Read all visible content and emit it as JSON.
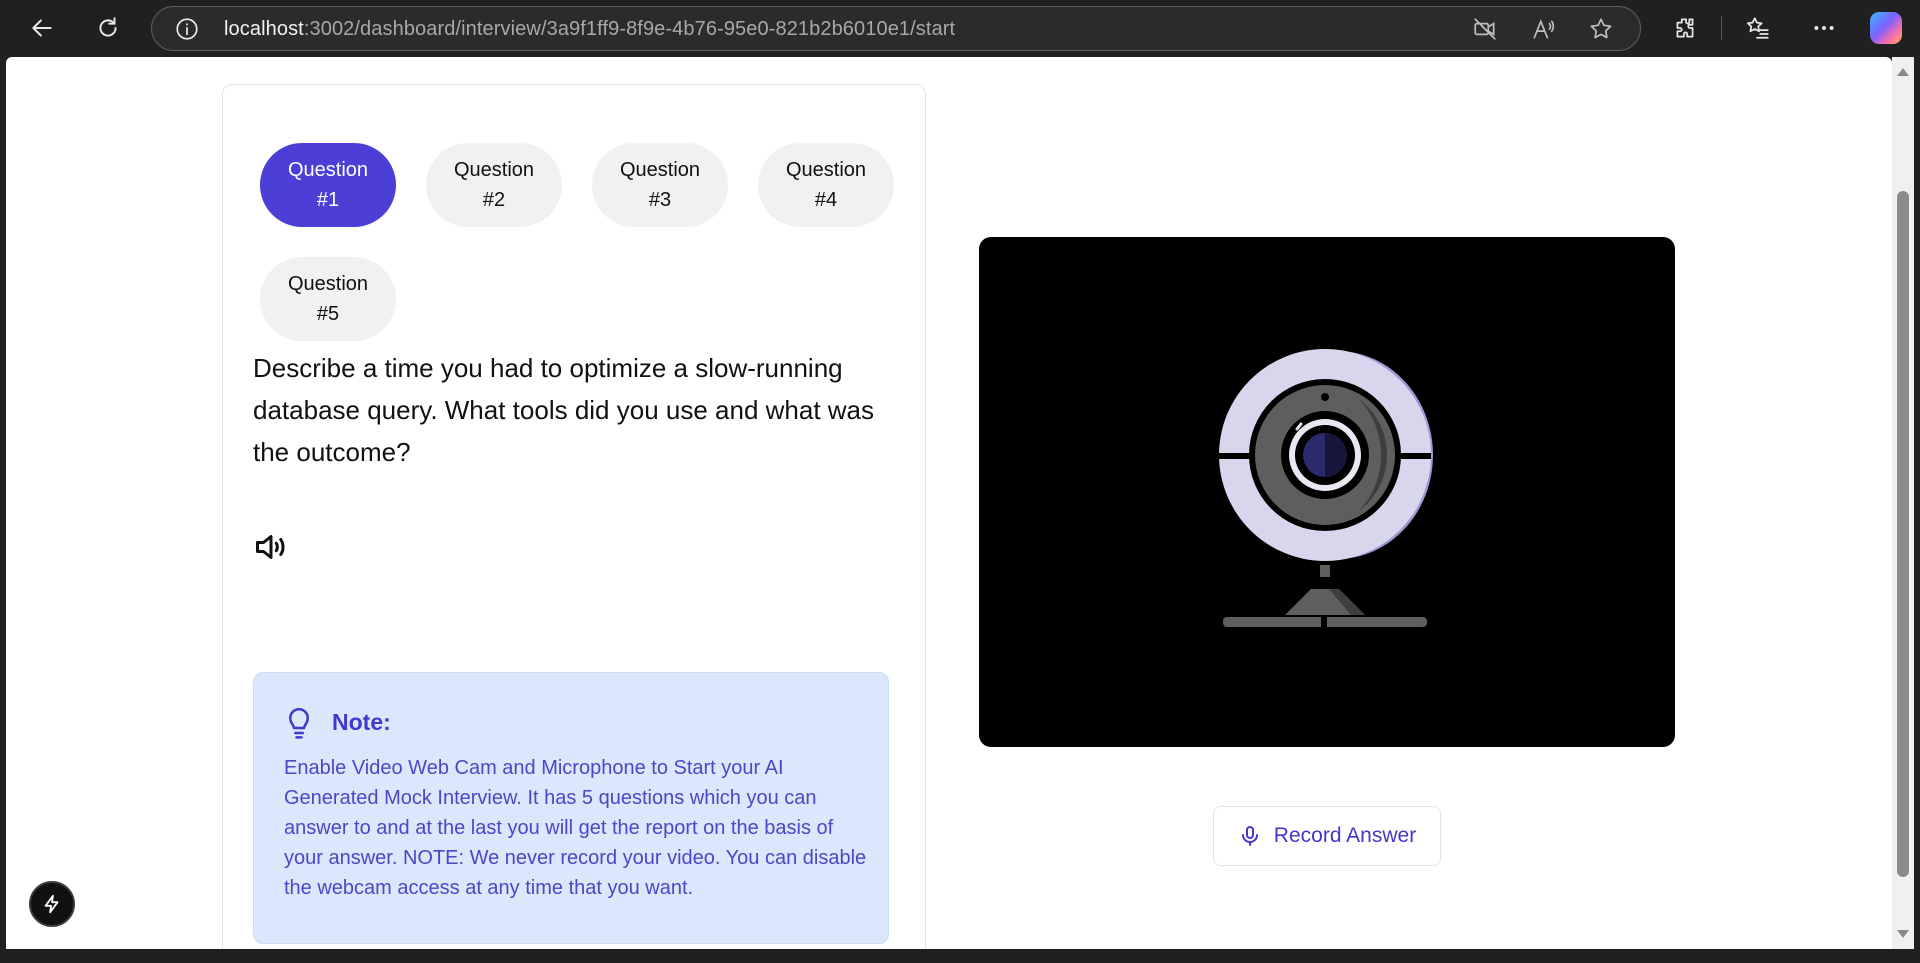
{
  "browser": {
    "url_host": "localhost",
    "url_rest": ":3002/dashboard/interview/3a9f1ff9-8f9e-4b76-95e0-821b2b6010e1/start",
    "icons": [
      "back-icon",
      "refresh-icon",
      "info-icon",
      "camera-off-icon",
      "read-aloud-icon",
      "favorite-star-icon",
      "extensions-icon",
      "favorites-list-icon",
      "more-icon",
      "copilot-icon"
    ]
  },
  "questions": {
    "tabs": [
      {
        "line1": "Question",
        "line2": "#1",
        "active": true
      },
      {
        "line1": "Question",
        "line2": "#2",
        "active": false
      },
      {
        "line1": "Question",
        "line2": "#3",
        "active": false
      },
      {
        "line1": "Question",
        "line2": "#4",
        "active": false
      },
      {
        "line1": "Question",
        "line2": "#5",
        "active": false
      }
    ],
    "current_text": "Describe a time you had to optimize a slow-running database query. What tools did you use and what was the outcome?"
  },
  "note": {
    "title": "Note:",
    "body": "Enable Video Web Cam and Microphone to Start your AI Generated Mock Interview. It has 5 questions which you can answer to and at the last you will get the report on the basis of your answer. NOTE: We never record your video. You can disable the webcam access at any time that you want."
  },
  "record": {
    "label": "Record Answer"
  },
  "colors": {
    "accent": "#4b3fd6",
    "note_bg": "#dbe8fb",
    "note_text": "#4c46c8"
  }
}
